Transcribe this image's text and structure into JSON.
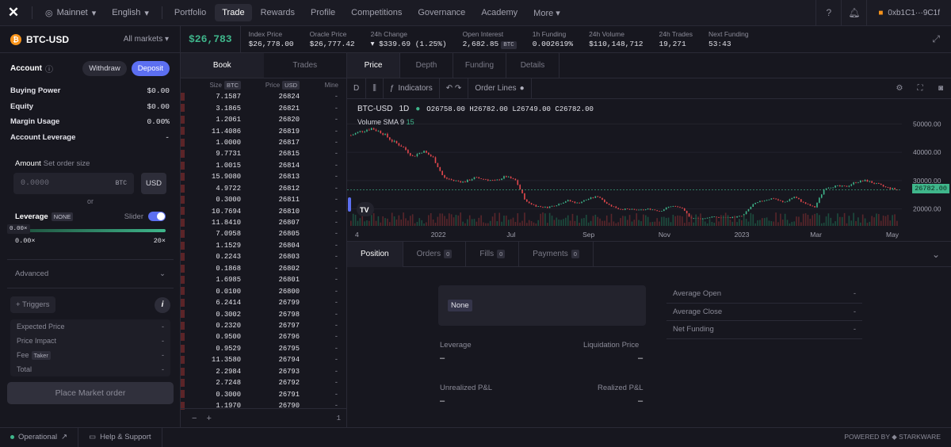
{
  "topbar": {
    "network": "Mainnet",
    "language": "English",
    "nav": [
      "Portfolio",
      "Trade",
      "Rewards",
      "Profile",
      "Competitions",
      "Governance",
      "Academy",
      "More"
    ],
    "wallet": "0xb1C1···9C1f"
  },
  "market": {
    "name": "BTC-USD",
    "all_markets": "All markets",
    "price": "$26,783",
    "stats": [
      {
        "label": "Index Price",
        "value": "$26,778.00"
      },
      {
        "label": "Oracle Price",
        "value": "$26,777.42"
      },
      {
        "label": "24h Change",
        "value": "▾ $339.69 (1.25%)"
      },
      {
        "label": "Open Interest",
        "value": "2,682.85",
        "tag": "BTC"
      },
      {
        "label": "1h Funding",
        "value": "0.002619%"
      },
      {
        "label": "24h Volume",
        "value": "$110,148,712"
      },
      {
        "label": "24h Trades",
        "value": "19,271"
      },
      {
        "label": "Next Funding",
        "value": "53:43"
      }
    ]
  },
  "account": {
    "title": "Account",
    "withdraw": "Withdraw",
    "deposit": "Deposit",
    "rows": [
      {
        "label": "Buying Power",
        "value": "$0.00"
      },
      {
        "label": "Equity",
        "value": "$0.00"
      },
      {
        "label": "Margin Usage",
        "value": "0.00%"
      },
      {
        "label": "Account Leverage",
        "value": "-"
      }
    ]
  },
  "order": {
    "amount_label": "Amount",
    "amount_hint": "Set order size",
    "amount_placeholder": "0.0000",
    "amount_unit": "BTC",
    "usd": "USD",
    "or": "or",
    "leverage_label": "Leverage",
    "leverage_badge": "NONE",
    "slider_label": "Slider",
    "leverage_value": "0.00×",
    "leverage_min": "0.00×",
    "leverage_max": "20×",
    "advanced": "Advanced",
    "triggers": "+ Triggers",
    "details": [
      {
        "label": "Expected Price",
        "value": "-"
      },
      {
        "label": "Price Impact",
        "value": "-"
      },
      {
        "label": "Fee",
        "tag": "Taker",
        "value": "-"
      },
      {
        "label": "Total",
        "value": "-"
      }
    ],
    "place": "Place Market order"
  },
  "book": {
    "tabs": [
      "Book",
      "Trades"
    ],
    "headers": {
      "size": "Size",
      "size_tag": "BTC",
      "price": "Price",
      "price_tag": "USD",
      "mine": "Mine"
    },
    "rows": [
      [
        "7.1587",
        "26824",
        "-"
      ],
      [
        "3.1865",
        "26821",
        "-"
      ],
      [
        "1.2061",
        "26820",
        "-"
      ],
      [
        "11.4086",
        "26819",
        "-"
      ],
      [
        "1.0000",
        "26817",
        "-"
      ],
      [
        "9.7731",
        "26815",
        "-"
      ],
      [
        "1.0015",
        "26814",
        "-"
      ],
      [
        "15.9080",
        "26813",
        "-"
      ],
      [
        "4.9722",
        "26812",
        "-"
      ],
      [
        "0.3000",
        "26811",
        "-"
      ],
      [
        "10.7694",
        "26810",
        "-"
      ],
      [
        "11.8410",
        "26807",
        "-"
      ],
      [
        "7.0958",
        "26805",
        "-"
      ],
      [
        "1.1529",
        "26804",
        "-"
      ],
      [
        "0.2243",
        "26803",
        "-"
      ],
      [
        "0.1868",
        "26802",
        "-"
      ],
      [
        "1.6985",
        "26801",
        "-"
      ],
      [
        "0.0100",
        "26800",
        "-"
      ],
      [
        "6.2414",
        "26799",
        "-"
      ],
      [
        "0.3002",
        "26798",
        "-"
      ],
      [
        "0.2320",
        "26797",
        "-"
      ],
      [
        "0.9500",
        "26796",
        "-"
      ],
      [
        "0.9529",
        "26795",
        "-"
      ],
      [
        "11.3580",
        "26794",
        "-"
      ],
      [
        "2.2984",
        "26793",
        "-"
      ],
      [
        "2.7248",
        "26792",
        "-"
      ],
      [
        "0.3000",
        "26791",
        "-"
      ],
      [
        "1.1970",
        "26790",
        "-"
      ]
    ],
    "footer": {
      "minus": "−",
      "plus": "+",
      "zoom": "1"
    }
  },
  "chart_tabs": [
    "Price",
    "Depth",
    "Funding",
    "Details"
  ],
  "chart_toolbar": {
    "interval": "D",
    "indicators": "Indicators",
    "order_lines": "Order Lines"
  },
  "chart_legend": {
    "symbol": "BTC-USD",
    "tf": "1D",
    "o": "O26758.00",
    "h": "H26782.00",
    "l": "L26749.00",
    "c": "C26782.00",
    "volume": "Volume SMA 9",
    "volume_val": "15"
  },
  "chart_data": {
    "type": "candlestick",
    "y_ticks": [
      "50000.00",
      "40000.00",
      "30000.00",
      "20000.00"
    ],
    "x_ticks": [
      "4",
      "2022",
      "Jul",
      "Sep",
      "Nov",
      "2023",
      "Mar",
      "May"
    ],
    "last_price": "26782.00",
    "ylim": [
      14000,
      56000
    ],
    "series_close": [
      46000,
      47500,
      48500,
      47000,
      44000,
      42000,
      38500,
      40500,
      38000,
      31000,
      30000,
      29500,
      31000,
      30500,
      29800,
      31500,
      30000,
      22500,
      21000,
      20500,
      21500,
      23000,
      22000,
      23500,
      24500,
      21500,
      20000,
      19800,
      19500,
      20000,
      19200,
      21000,
      20500,
      16800,
      16500,
      17200,
      16900,
      17000,
      17500,
      21500,
      23000,
      23800,
      22200,
      24300,
      22000,
      20500,
      27500,
      28000,
      27800,
      29500,
      30000,
      28800,
      27500,
      26782
    ]
  },
  "positions": {
    "tabs": [
      {
        "label": "Position"
      },
      {
        "label": "Orders",
        "count": "0"
      },
      {
        "label": "Fills",
        "count": "0"
      },
      {
        "label": "Payments",
        "count": "0"
      }
    ],
    "none": "None",
    "leverage": "Leverage",
    "liq": "Liquidation Price",
    "upnl": "Unrealized P&L",
    "rpnl": "Realized P&L",
    "dash": "–",
    "avg": [
      {
        "label": "Average Open",
        "value": "-"
      },
      {
        "label": "Average Close",
        "value": "-"
      },
      {
        "label": "Net Funding",
        "value": "-"
      }
    ]
  },
  "footer": {
    "status": "Operational",
    "help": "Help & Support",
    "powered": "POWERED BY ◆ STARKWARE"
  }
}
